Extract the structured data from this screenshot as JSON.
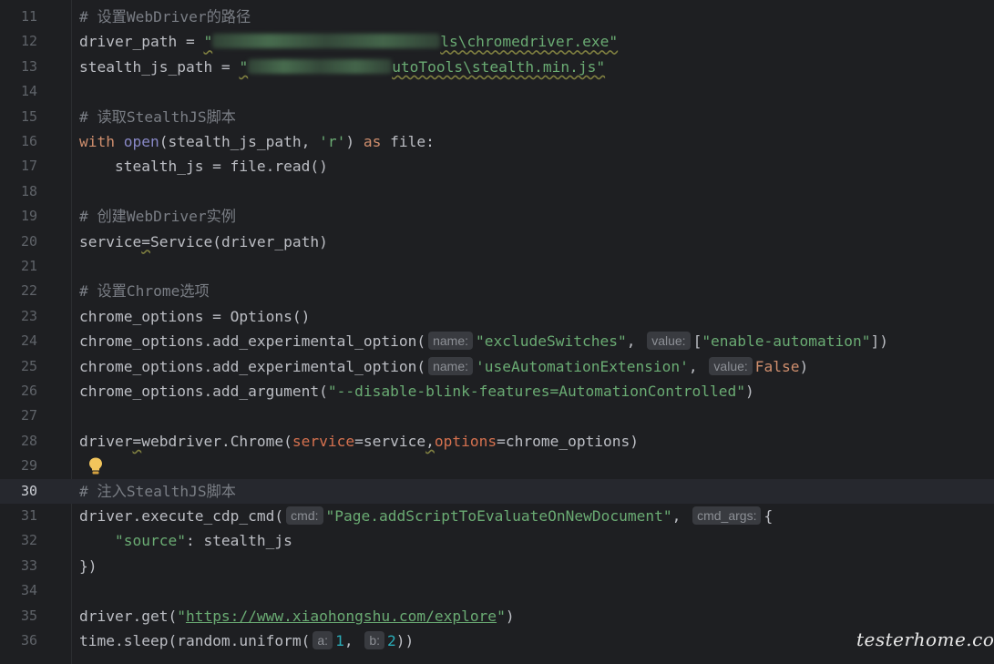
{
  "editor": {
    "lines": [
      {
        "n": "11",
        "tokens": [
          {
            "c": "cm",
            "t": "# 设置WebDriver的路径"
          }
        ]
      },
      {
        "n": "12",
        "tokens": [
          {
            "t": "driver_path = "
          },
          {
            "c": "str wavy",
            "t": "\""
          },
          {
            "blur": 250
          },
          {
            "c": "str wavy",
            "t": "ls\\chromedriver.exe\""
          }
        ]
      },
      {
        "n": "13",
        "tokens": [
          {
            "t": "stealth_js_path = "
          },
          {
            "c": "str wavy",
            "t": "\""
          },
          {
            "blur": 158
          },
          {
            "c": "str wavy",
            "t": "utoTools\\stealth.min.js\""
          }
        ]
      },
      {
        "n": "14",
        "tokens": []
      },
      {
        "n": "15",
        "tokens": [
          {
            "c": "cm",
            "t": "# 读取StealthJS脚本"
          }
        ]
      },
      {
        "n": "16",
        "tokens": [
          {
            "c": "kw",
            "t": "with "
          },
          {
            "c": "bi",
            "t": "open"
          },
          {
            "t": "(stealth_js_path, "
          },
          {
            "c": "str",
            "t": "'r'"
          },
          {
            "t": ") "
          },
          {
            "c": "kw",
            "t": "as "
          },
          {
            "t": "file:"
          }
        ]
      },
      {
        "n": "17",
        "tokens": [
          {
            "t": "    stealth_js = file.read()"
          }
        ]
      },
      {
        "n": "18",
        "tokens": []
      },
      {
        "n": "19",
        "tokens": [
          {
            "c": "cm",
            "t": "# 创建WebDriver实例"
          }
        ]
      },
      {
        "n": "20",
        "tokens": [
          {
            "t": "service"
          },
          {
            "c": "wavy",
            "t": "="
          },
          {
            "t": "Service(driver_path)"
          }
        ]
      },
      {
        "n": "21",
        "tokens": []
      },
      {
        "n": "22",
        "tokens": [
          {
            "c": "cm",
            "t": "# 设置Chrome选项"
          }
        ]
      },
      {
        "n": "23",
        "tokens": [
          {
            "t": "chrome_options = Options()"
          }
        ]
      },
      {
        "n": "24",
        "tokens": [
          {
            "t": "chrome_options.add_experimental_option("
          },
          {
            "hint": "name:"
          },
          {
            "c": "str",
            "t": "\"excludeSwitches\""
          },
          {
            "t": ", "
          },
          {
            "hint": "value:"
          },
          {
            "t": "["
          },
          {
            "c": "str",
            "t": "\"enable-automation\""
          },
          {
            "t": "])"
          }
        ]
      },
      {
        "n": "25",
        "tokens": [
          {
            "t": "chrome_options.add_experimental_option("
          },
          {
            "hint": "name:"
          },
          {
            "c": "str",
            "t": "'useAutomationExtension'"
          },
          {
            "t": ", "
          },
          {
            "hint": "value:"
          },
          {
            "c": "kw",
            "t": "False"
          },
          {
            "t": ")"
          }
        ]
      },
      {
        "n": "26",
        "tokens": [
          {
            "t": "chrome_options.add_argument("
          },
          {
            "c": "str",
            "t": "\"--disable-blink-features=AutomationControlled\""
          },
          {
            "t": ")"
          }
        ]
      },
      {
        "n": "27",
        "tokens": []
      },
      {
        "n": "28",
        "tokens": [
          {
            "t": "driver"
          },
          {
            "c": "wavy",
            "t": "="
          },
          {
            "t": "webdriver.Chrome("
          },
          {
            "c": "named",
            "t": "service"
          },
          {
            "t": "=service"
          },
          {
            "c": "wavy",
            "t": ","
          },
          {
            "c": "named",
            "t": "options"
          },
          {
            "t": "=chrome_options)"
          }
        ]
      },
      {
        "n": "29",
        "tokens": [],
        "bulb": true
      },
      {
        "n": "30",
        "current": true,
        "tokens": [
          {
            "c": "cm",
            "t": "# 注入StealthJS脚本"
          }
        ]
      },
      {
        "n": "31",
        "tokens": [
          {
            "t": "driver.execute_cdp_cmd("
          },
          {
            "hint": "cmd:"
          },
          {
            "c": "str",
            "t": "\"Page.addScriptToEvaluateOnNewDocument\""
          },
          {
            "t": ", "
          },
          {
            "hint": "cmd_args:"
          },
          {
            "t": "{"
          }
        ]
      },
      {
        "n": "32",
        "tokens": [
          {
            "t": "    "
          },
          {
            "c": "str",
            "t": "\"source\""
          },
          {
            "t": ": stealth_js"
          }
        ]
      },
      {
        "n": "33",
        "tokens": [
          {
            "t": "})"
          }
        ]
      },
      {
        "n": "34",
        "tokens": []
      },
      {
        "n": "35",
        "tokens": [
          {
            "t": "driver.get("
          },
          {
            "c": "str",
            "t": "\""
          },
          {
            "c": "str url",
            "t": "https://www.xiaohongshu.com/explore"
          },
          {
            "c": "str",
            "t": "\""
          },
          {
            "t": ")"
          }
        ]
      },
      {
        "n": "36",
        "tokens": [
          {
            "t": "time.sleep(random.uniform("
          },
          {
            "hint": "a:"
          },
          {
            "c": "num",
            "t": "1"
          },
          {
            "t": ", "
          },
          {
            "hint": "b:"
          },
          {
            "c": "num",
            "t": "2"
          },
          {
            "t": "))"
          }
        ]
      }
    ]
  },
  "watermark": "testerhome.com",
  "colors": {
    "background": "#1e1f22",
    "current_line": "#26282e",
    "comment": "#7a7e85",
    "string": "#6aab73",
    "keyword": "#cf8e6d",
    "builtin": "#8888c6",
    "number": "#2aacb8",
    "named_arg": "#d5714f",
    "text": "#bcbec4",
    "hint_bg": "#393b40"
  },
  "icons": {
    "intention": "lightbulb-icon"
  }
}
